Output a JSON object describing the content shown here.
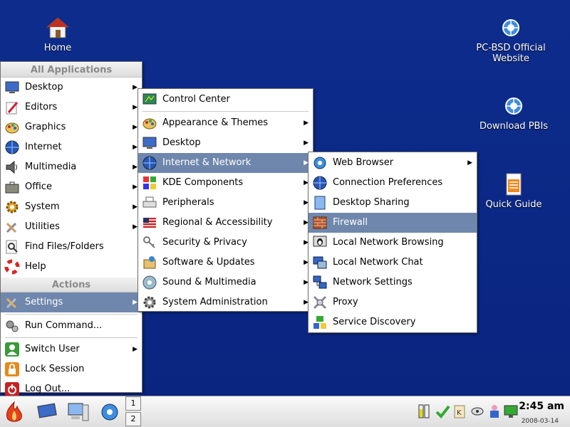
{
  "desktop": {
    "icons": {
      "home": "Home",
      "pcbsd": "PC-BSD Official Website",
      "pbis": "Download PBIs",
      "guide": "Quick Guide"
    }
  },
  "main_menu": {
    "header_all": "All Applications",
    "apps": [
      "Desktop",
      "Editors",
      "Graphics",
      "Internet",
      "Multimedia",
      "Office",
      "System",
      "Utilities",
      "Find Files/Folders",
      "Help"
    ],
    "header_actions": "Actions",
    "settings": "Settings",
    "run": "Run Command...",
    "switch_user": "Switch User",
    "lock": "Lock Session",
    "logout": "Log Out..."
  },
  "settings_menu": {
    "items": [
      "Control Center",
      "Appearance & Themes",
      "Desktop",
      "Internet & Network",
      "KDE Components",
      "Peripherals",
      "Regional & Accessibility",
      "Security & Privacy",
      "Software & Updates",
      "Sound & Multimedia",
      "System Administration"
    ]
  },
  "network_menu": {
    "items": [
      "Web Browser",
      "Connection Preferences",
      "Desktop Sharing",
      "Firewall",
      "Local Network Browsing",
      "Local Network Chat",
      "Network Settings",
      "Proxy",
      "Service Discovery"
    ]
  },
  "taskbar": {
    "pager": [
      "1",
      "2"
    ],
    "time": "2:45 am",
    "date": "2008-03-14"
  },
  "colors": {
    "desktop_bg": "#0b2a8a",
    "menu_highlight": "#6f87ac"
  }
}
